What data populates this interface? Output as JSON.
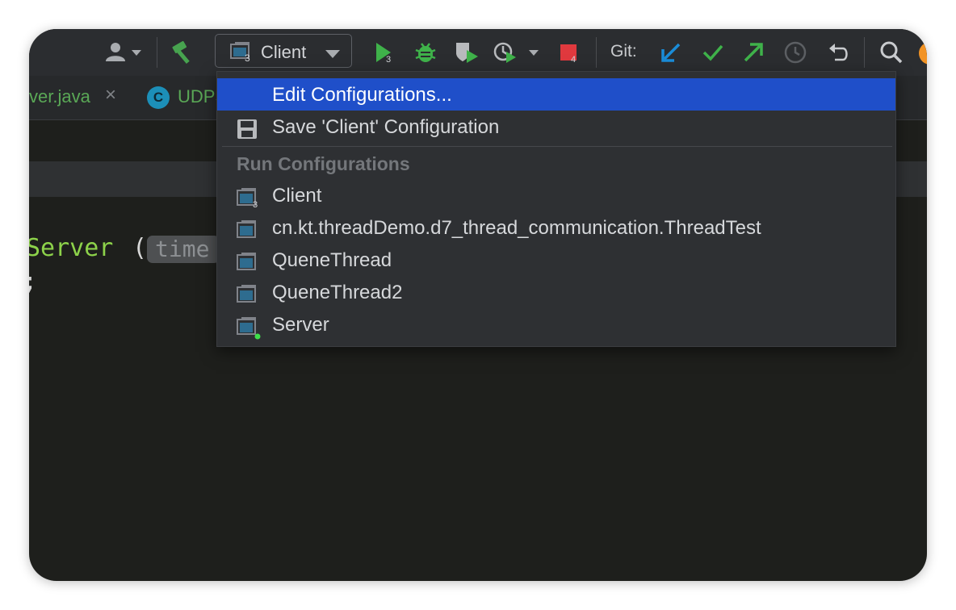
{
  "toolbar": {
    "config_selector": {
      "label": "Client",
      "badge": "3"
    },
    "run_badge": "3",
    "stop_badge": "4",
    "git_label": "Git:"
  },
  "tabs": [
    {
      "label": "ver.java",
      "close": "×"
    },
    {
      "label": "UDPS",
      "badge": "C"
    }
  ],
  "editor": {
    "code_token": "Server",
    "paren": "(",
    "param_hint": "time",
    "line2": ";"
  },
  "dropdown": {
    "edit_configurations": "Edit Configurations...",
    "save_configuration": "Save 'Client' Configuration",
    "section_header": "Run Configurations",
    "configurations": [
      {
        "label": "Client",
        "badge": "3"
      },
      {
        "label": "cn.kt.threadDemo.d7_thread_communication.ThreadTest"
      },
      {
        "label": "QueneThread"
      },
      {
        "label": "QueneThread2"
      },
      {
        "label": "Server",
        "running": true
      }
    ]
  },
  "colors": {
    "selection": "#1f4fc9",
    "run_green": "#3fb24a",
    "stop_red": "#e0393e",
    "git_update_blue": "#1a8cd8"
  }
}
